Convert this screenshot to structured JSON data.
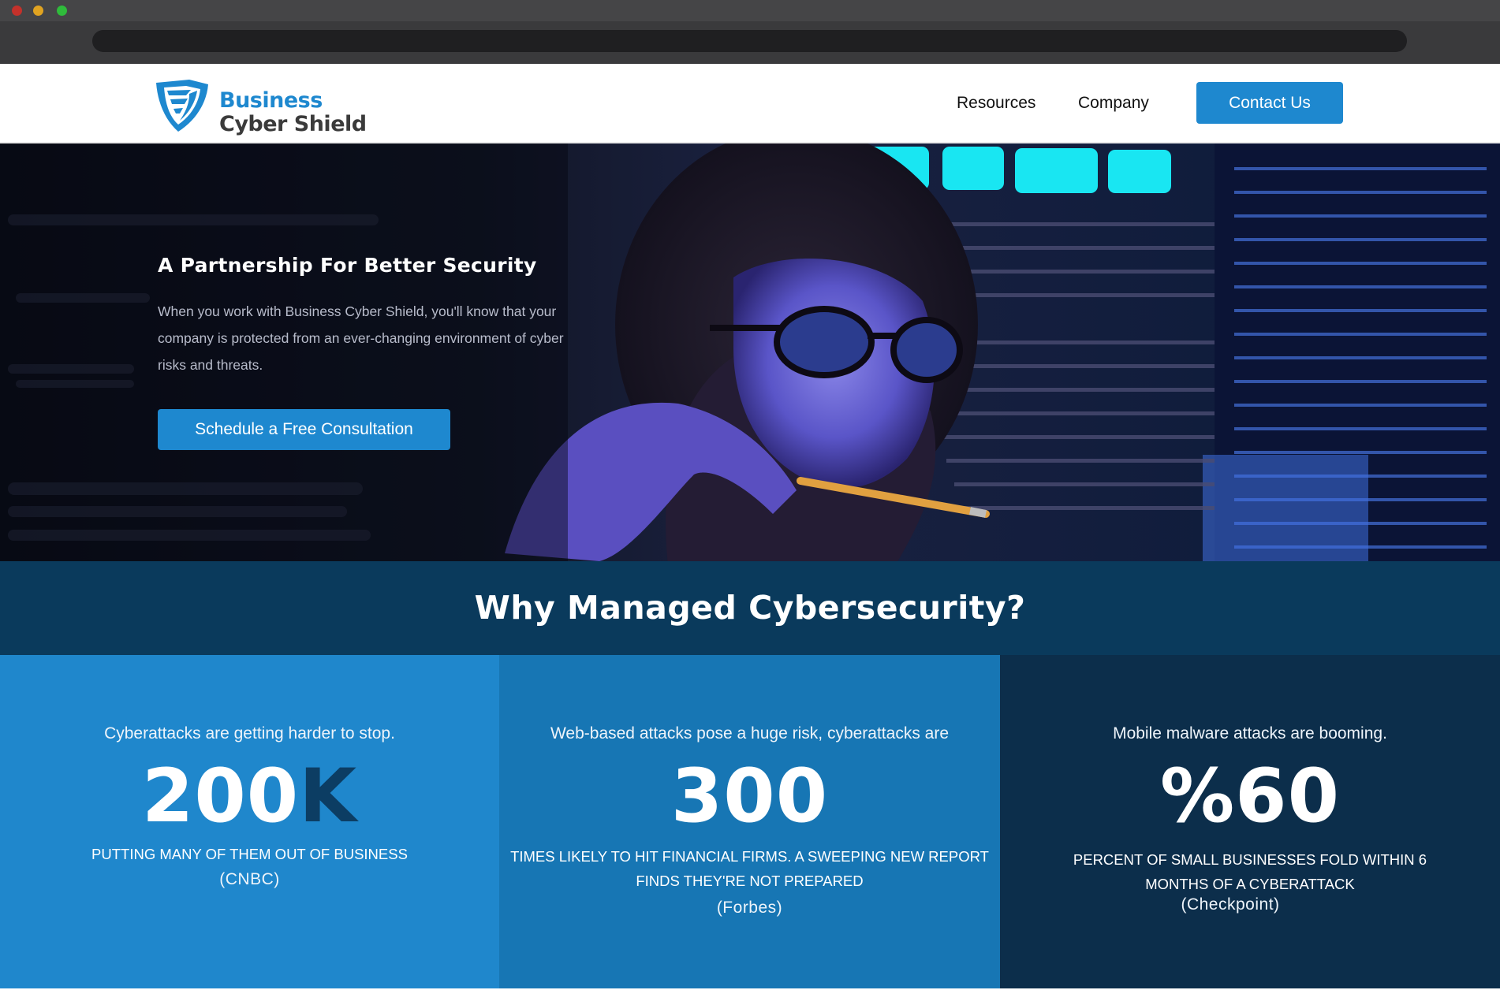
{
  "colors": {
    "brand_blue": "#1e88cf",
    "dark_navy": "#0a3a5c",
    "logo_gray": "#3b3b3b",
    "panel_1": "#1f87cc",
    "panel_2": "#1776b4",
    "panel_3": "#0c2e4b"
  },
  "header": {
    "logo": {
      "line1": "Business",
      "line2": "Cyber Shield",
      "icon": "shield-logo-icon"
    },
    "nav": [
      {
        "label": "Resources"
      },
      {
        "label": "Company"
      }
    ],
    "cta_label": "Contact Us"
  },
  "hero": {
    "title": "A Partnership For Better Security",
    "text": "When you work with Business Cyber Shield, you'll know that your company is protected from an ever-changing environment of cyber risks and threats.",
    "button_label": "Schedule a Free Consultation"
  },
  "why": {
    "title": "Why Managed Cybersecurity?"
  },
  "stats": [
    {
      "lead": "Cyberattacks are getting harder to stop.",
      "number_main": "200",
      "number_accent": "K",
      "description": "PUTTING MANY OF THEM OUT OF BUSINESS",
      "source": "(CNBC)"
    },
    {
      "lead": "Web-based attacks pose a huge risk, cyberattacks are",
      "number_main": "300",
      "number_accent": "",
      "description": "TIMES LIKELY TO HIT FINANCIAL FIRMS. A SWEEPING NEW REPORT FINDS THEY'RE NOT PREPARED",
      "source": "(Forbes)"
    },
    {
      "lead": "Mobile malware attacks are booming.",
      "number_main": "%60",
      "number_accent": "",
      "description": "PERCENT OF SMALL BUSINESSES FOLD WITHIN 6 MONTHS OF A CYBERATTACK",
      "source": "(Checkpoint)"
    }
  ]
}
